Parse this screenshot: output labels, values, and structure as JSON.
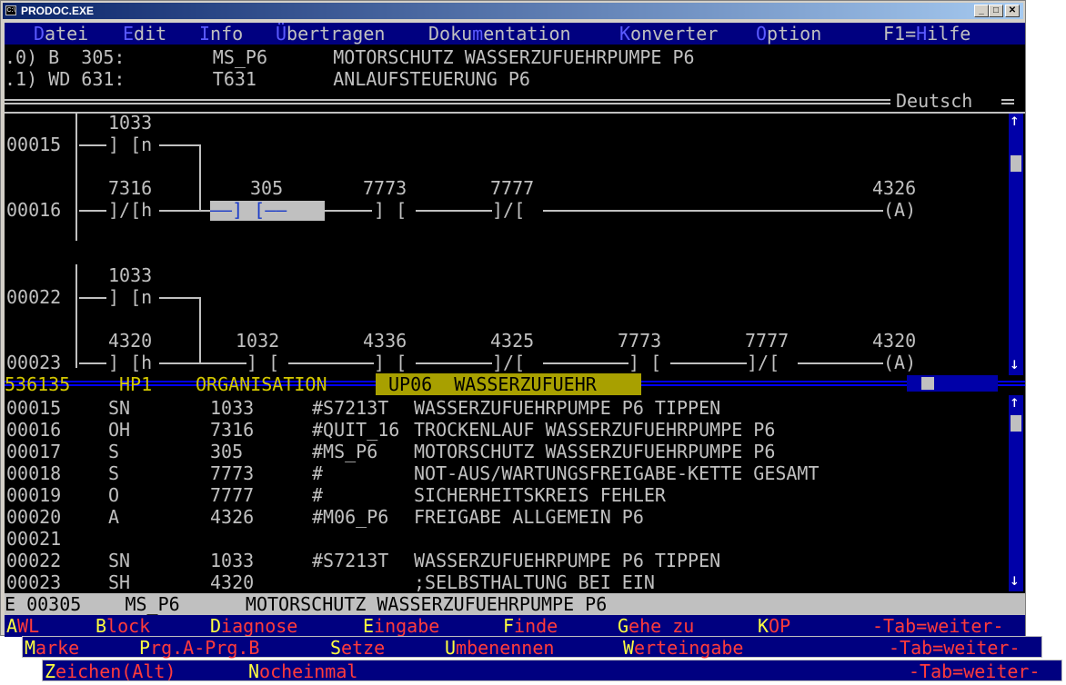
{
  "window": {
    "title": "PRODOC.EXE",
    "icon": "console-icon",
    "min": "_",
    "max": "□",
    "close": "✕"
  },
  "menu": {
    "items": [
      {
        "pre": "",
        "hot": "D",
        "post": "atei"
      },
      {
        "pre": "",
        "hot": "E",
        "post": "dit"
      },
      {
        "pre": "",
        "hot": "I",
        "post": "nfo"
      },
      {
        "pre": "",
        "hot": "Ü",
        "post": "bertragen"
      },
      {
        "pre": "Doku",
        "hot": "m",
        "post": "entation"
      },
      {
        "pre": "",
        "hot": "K",
        "post": "onverter"
      },
      {
        "pre": "",
        "hot": "O",
        "post": "ption"
      },
      {
        "pre": "F1=",
        "hot": "H",
        "post": "ilfe"
      }
    ]
  },
  "header": {
    "line0": ".0) B  305:        MS_P6      MOTORSCHUTZ WASSERZUFUEHRPUMPE P6",
    "line1": ".1) WD 631:        T631       ANLAUFSTEUERUNG P6",
    "language": "Deutsch"
  },
  "ladder": {
    "r1_addr": "1033",
    "r1_line": "00015",
    "r1_contact": "] [n",
    "r2_a": "7316",
    "r2_b": "305",
    "r2_c": "7773",
    "r2_d": "7777",
    "r2_out": "4326",
    "r2_line": "00016",
    "r2_c1": "]/[h",
    "r2_c2": "] [",
    "r2_c3": "] [",
    "r2_c4": "]/[",
    "r2_coil": "(A)",
    "r3_addr": "1033",
    "r3_line": "00022",
    "r3_contact": "] [n",
    "r4_a": "4320",
    "r4_b": "1032",
    "r4_c": "4336",
    "r4_d": "4325",
    "r4_e": "7773",
    "r4_f": "7777",
    "r4_out": "4320",
    "r4_line": "00023",
    "r4_c1": "] [h",
    "r4_c2": "] [",
    "r4_c3": "] [",
    "r4_c4": "]/[",
    "r4_c5": "] [",
    "r4_c6": "]/[",
    "r4_coil": "(A)"
  },
  "pathbar": {
    "id": "536135",
    "hp": "HP1",
    "org": "ORGANISATION",
    "up": "UP06  WASSERZUFUEHR"
  },
  "listing": [
    {
      "n": "00015",
      "op": "SN",
      "addr": "1033",
      "sym": "#S7213T",
      "text": "WASSERZUFUEHRPUMPE P6 TIPPEN"
    },
    {
      "n": "00016",
      "op": "OH",
      "addr": "7316",
      "sym": "#QUIT_16",
      "text": "TROCKENLAUF WASSERZUFUEHRPUMPE P6"
    },
    {
      "n": "00017",
      "op": "S",
      "addr": "305",
      "sym": "#MS_P6",
      "text": "MOTORSCHUTZ WASSERZUFUEHRPUMPE P6"
    },
    {
      "n": "00018",
      "op": "S",
      "addr": "7773",
      "sym": "#",
      "text": "NOT-AUS/WARTUNGSFREIGABE-KETTE GESAMT"
    },
    {
      "n": "00019",
      "op": "O",
      "addr": "7777",
      "sym": "#",
      "text": "SICHERHEITSKREIS FEHLER"
    },
    {
      "n": "00020",
      "op": "A",
      "addr": "4326",
      "sym": "#M06_P6",
      "text": "FREIGABE ALLGEMEIN P6"
    },
    {
      "n": "00021",
      "op": "",
      "addr": "",
      "sym": "",
      "text": ""
    },
    {
      "n": "00022",
      "op": "SN",
      "addr": "1033",
      "sym": "#S7213T",
      "text": "WASSERZUFUEHRPUMPE P6 TIPPEN"
    },
    {
      "n": "00023",
      "op": "SH",
      "addr": "4320",
      "sym": "",
      "text": ";SELBSTHALTUNG BEI EIN"
    }
  ],
  "status": "E 00305    MS_P6      MOTORSCHUTZ WASSERZUFUEHRPUMPE P6",
  "fbar1": [
    {
      "hot": "A",
      "rest": "WL"
    },
    {
      "hot": "B",
      "rest": "lock"
    },
    {
      "hot": "D",
      "rest": "iagnose"
    },
    {
      "hot": "E",
      "rest": "ingabe"
    },
    {
      "hot": "F",
      "rest": "inde"
    },
    {
      "hot": "G",
      "rest": "ehe zu"
    },
    {
      "hot": "K",
      "rest": "OP"
    },
    {
      "hot": "",
      "rest": "-Tab=weiter-"
    }
  ],
  "fbar2": [
    {
      "hot": "M",
      "rest": "arke"
    },
    {
      "hot": "P",
      "rest": "rg.A-Prg.B"
    },
    {
      "hot": "S",
      "rest": "etze"
    },
    {
      "hot": "U",
      "rest": "mbenennen"
    },
    {
      "hot": "W",
      "rest": "erteingabe"
    },
    {
      "hot": "",
      "rest": "-Tab=weiter-"
    }
  ],
  "fbar3": [
    {
      "hot": "Z",
      "rest": "eichen(Alt)"
    },
    {
      "hot": "N",
      "rest": "ocheinmal"
    },
    {
      "hot": "",
      "rest": "-Tab=weiter-"
    }
  ],
  "colors": {
    "bg": "#000000",
    "fg": "#c0c0c0",
    "menu": "#000080",
    "hot": "#ffff40",
    "red": "#ff3b3b",
    "path": "#d4c800"
  }
}
